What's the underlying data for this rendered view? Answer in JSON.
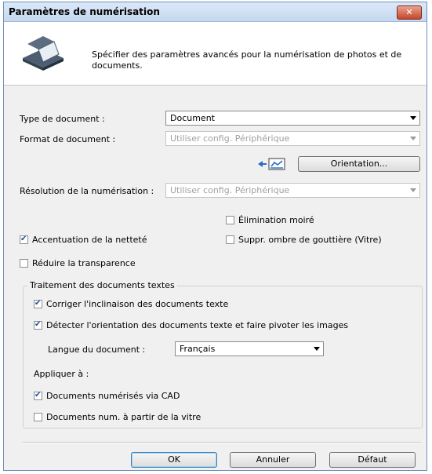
{
  "window": {
    "title": "Paramètres de numérisation",
    "close_label": "✕"
  },
  "header": {
    "description": "Spécifier des paramètres avancés pour la numérisation de photos et de documents."
  },
  "document_type": {
    "label": "Type de document :",
    "value": "Document"
  },
  "document_format": {
    "label": "Format de document :",
    "value": "Utiliser config. Périphérique"
  },
  "orientation": {
    "button_label": "Orientation..."
  },
  "resolution": {
    "label": "Résolution de la numérisation :",
    "value": "Utiliser config. Périphérique"
  },
  "options": {
    "moire": {
      "label": "Élimination moiré",
      "checked": false
    },
    "sharpen": {
      "label": "Accentuation de la netteté",
      "checked": true
    },
    "gutter": {
      "label": "Suppr. ombre de gouttière (Vitre)",
      "checked": false
    },
    "transparency": {
      "label": "Réduire la transparence",
      "checked": false
    }
  },
  "text_processing": {
    "title": "Traitement des documents textes",
    "correct_slant": {
      "label": "Corriger l'inclinaison des documents texte",
      "checked": true
    },
    "detect_orientation": {
      "label": "Détecter l'orientation des documents texte et faire pivoter les images",
      "checked": true
    },
    "language": {
      "label": "Langue du document :",
      "value": "Français"
    },
    "apply_to": {
      "label": "Appliquer à :",
      "adf": {
        "label": "Documents numérisés via CAD",
        "checked": true
      },
      "platen": {
        "label": "Documents num. à partir de la vitre",
        "checked": false
      }
    }
  },
  "footer": {
    "ok_label": "OK",
    "cancel_label": "Annuler",
    "default_label": "Défaut"
  }
}
